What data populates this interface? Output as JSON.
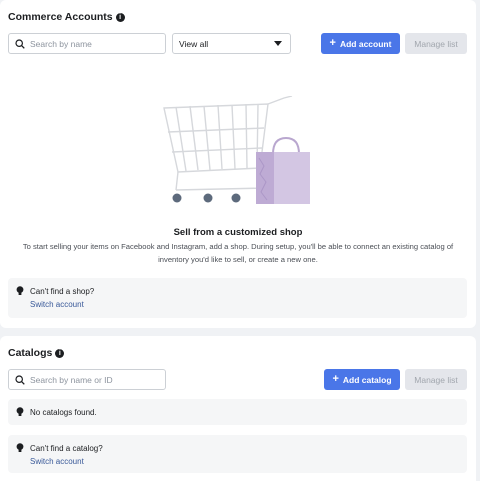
{
  "commerce": {
    "title": "Commerce Accounts",
    "search_placeholder": "Search by name",
    "filter_value": "View all",
    "add_label": "Add account",
    "manage_label": "Manage list",
    "empty_title": "Sell from a customized shop",
    "empty_desc": "To start selling your items on Facebook and Instagram, add a shop. During setup, you'll be able to connect an existing catalog of inventory you'd like to sell, or create a new one.",
    "hint_text": "Can't find a shop?",
    "hint_link": "Switch account"
  },
  "catalogs": {
    "title": "Catalogs",
    "search_placeholder": "Search by name or ID",
    "add_label": "Add catalog",
    "manage_label": "Manage list",
    "none_text": "No catalogs found.",
    "hint_text": "Can't find a catalog?",
    "hint_link": "Switch account"
  },
  "colors": {
    "primary": "#4a76e8",
    "link": "#385898",
    "bag": "#c9b7dc"
  },
  "icons": [
    "info-icon",
    "search-icon",
    "chevron-down-icon",
    "plus-icon",
    "lightbulb-icon",
    "shopping-cart-icon",
    "shopping-bag-icon"
  ]
}
